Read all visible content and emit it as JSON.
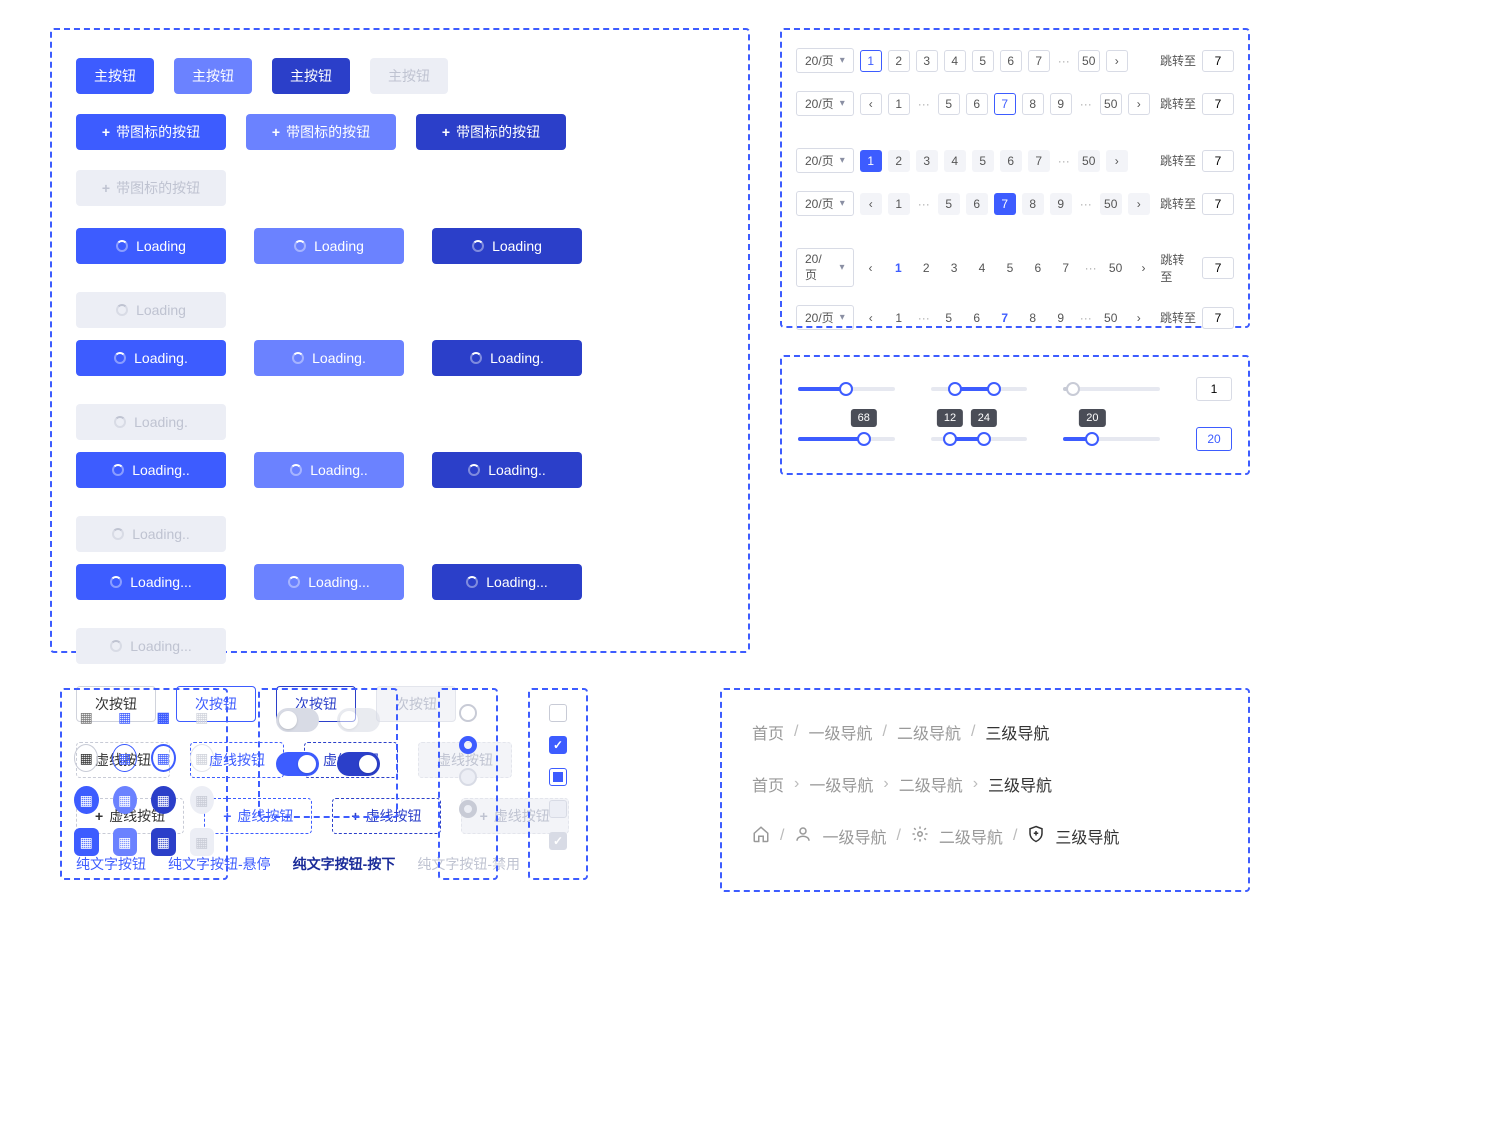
{
  "buttons": {
    "primary_label": "主按钮",
    "icon_label": "带图标的按钮",
    "loading0": "Loading",
    "loading1": "Loading.",
    "loading2": "Loading..",
    "loading3": "Loading...",
    "secondary_label": "次按钮",
    "dashed_label": "虚线按钮",
    "text_normal": "纯文字按钮",
    "text_hover": "纯文字按钮-悬停",
    "text_active": "纯文字按钮-按下",
    "text_disabled": "纯文字按钮-禁用"
  },
  "pagination": {
    "page_size_label": "20/页",
    "jump_label": "跳转至",
    "jump_value": "7",
    "row1": {
      "pages": [
        "1",
        "2",
        "3",
        "4",
        "5",
        "6",
        "7"
      ],
      "last": "50",
      "active": "1"
    },
    "row2": {
      "pre": "1",
      "pages": [
        "5",
        "6",
        "7",
        "8",
        "9"
      ],
      "last": "50",
      "active": "7"
    },
    "row3": {
      "pages": [
        "1",
        "2",
        "3",
        "4",
        "5",
        "6",
        "7"
      ],
      "last": "50",
      "active": "1"
    },
    "row4": {
      "pre": "1",
      "pages": [
        "5",
        "6",
        "7",
        "8",
        "9"
      ],
      "last": "50",
      "active": "7"
    },
    "row5": {
      "pages": [
        "1",
        "2",
        "3",
        "4",
        "5",
        "6",
        "7"
      ],
      "last": "50",
      "active": "1"
    },
    "row6": {
      "pre": "1",
      "pages": [
        "5",
        "6",
        "7",
        "8",
        "9"
      ],
      "last": "50",
      "active": "7"
    }
  },
  "sliders": {
    "r1a_percent": 50,
    "r1b_lo": 25,
    "r1b_hi": 65,
    "r1c_percent": 10,
    "r1c_disabled": true,
    "r1_input": "1",
    "r2a_percent": 68,
    "r2a_tip": "68",
    "r2b_lo": 20,
    "r2b_hi": 55,
    "r2b_tip_lo": "12",
    "r2b_tip_hi": "24",
    "r2c_percent": 30,
    "r2c_tip": "20",
    "r2_input": "20"
  },
  "breadcrumbs": {
    "home": "首页",
    "l1": "一级导航",
    "l2": "二级导航",
    "l3": "三级导航",
    "sep_slash": "/",
    "sep_chevron": "›"
  }
}
